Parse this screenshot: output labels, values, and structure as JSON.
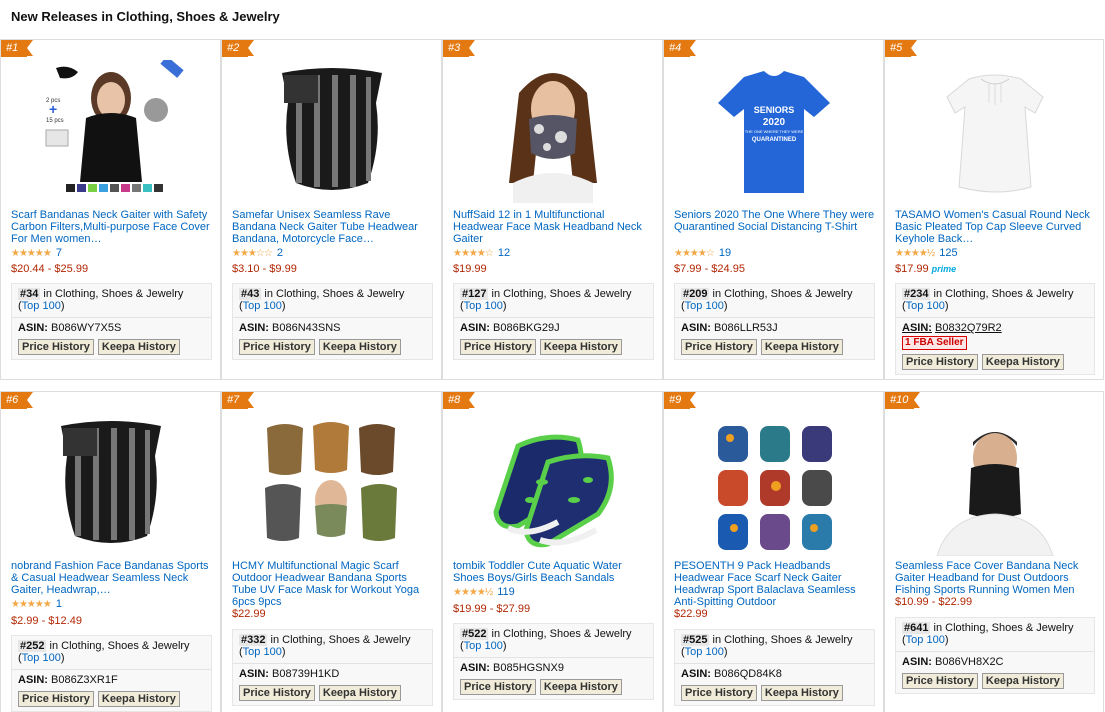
{
  "page": {
    "title": "New Releases in Clothing, Shoes & Jewelry"
  },
  "common": {
    "in_label": "in Clothing, Shoes & Jewelry",
    "top100": "Top 100",
    "asin_label": "ASIN:",
    "price_history": "Price History",
    "keepa_history": "Keepa History"
  },
  "products": [
    {
      "rank": "#1",
      "title": "Scarf Bandanas Neck Gaiter with Safety Carbon Filters,Multi-purpose Face Cover For Men women…",
      "stars": 5,
      "reviews": "7",
      "price": "$20.44 - $25.99",
      "sales_rank": "#34",
      "asin": "B086WY7X5S",
      "img_labels": [
        "2 pcs",
        "+",
        "15 pcs"
      ]
    },
    {
      "rank": "#2",
      "title": "Samefar Unisex Seamless Rave Bandana Neck Gaiter Tube Headwear Bandana, Motorcycle Face…",
      "stars": 3,
      "reviews": "2",
      "price": "$3.10 - $9.99",
      "sales_rank": "#43",
      "asin": "B086N43SNS"
    },
    {
      "rank": "#3",
      "title": "NuffSaid 12 in 1 Multifunctional Headwear Face Mask Headband Neck Gaiter",
      "stars": 3.5,
      "reviews": "12",
      "price": "$19.99",
      "sales_rank": "#127",
      "asin": "B086BKG29J"
    },
    {
      "rank": "#4",
      "title": "Seniors 2020 The One Where They were Quarantined Social Distancing T-Shirt",
      "stars": 4,
      "reviews": "19",
      "price": "$7.99 - $24.95",
      "sales_rank": "#209",
      "asin": "B086LLR53J",
      "shirt_text": [
        "SENIORS",
        "2020",
        "THE ONE WHERE THEY WERE",
        "QUARANTINED"
      ]
    },
    {
      "rank": "#5",
      "title": "TASAMO Women's Casual Round Neck Basic Pleated Top Cap Sleeve Curved Keyhole Back…",
      "stars": 4.5,
      "reviews": "125",
      "price": "$17.99",
      "prime": "prime",
      "sales_rank": "#234",
      "asin": "B0832Q79R2",
      "fba": "1 FBA Seller"
    },
    {
      "rank": "#6",
      "title": "nobrand Fashion Face Bandanas Sports & Casual Headwear Seamless Neck Gaiter, Headwrap,…",
      "stars": 5,
      "reviews": "1",
      "price": "$2.99 - $12.49",
      "sales_rank": "#252",
      "asin": "B086Z3XR1F"
    },
    {
      "rank": "#7",
      "title": "HCMY Multifunctional Magic Scarf Outdoor Headwear Bandana Sports Tube UV Face Mask for Workout Yoga 6pcs 9pcs",
      "price": "$22.99",
      "sales_rank": "#332",
      "asin": "B08739H1KD"
    },
    {
      "rank": "#8",
      "title": "tombik Toddler Cute Aquatic Water Shoes Boys/Girls Beach Sandals",
      "stars": 4.5,
      "reviews": "119",
      "price": "$19.99 - $27.99",
      "sales_rank": "#522",
      "asin": "B085HGSNX9"
    },
    {
      "rank": "#9",
      "title": "PESOENTH 9 Pack Headbands Headwear Face Scarf Neck Gaiter Headwrap Sport Balaclava Seamless Anti-Spitting Outdoor",
      "price": "$22.99",
      "sales_rank": "#525",
      "asin": "B086QD84K8"
    },
    {
      "rank": "#10",
      "title": "Seamless Face Cover Bandana Neck Gaiter Headband for Dust Outdoors Fishing Sports Running Women Men",
      "price": "$10.99 - $22.99",
      "sales_rank": "#641",
      "asin": "B086VH8X2C"
    }
  ]
}
